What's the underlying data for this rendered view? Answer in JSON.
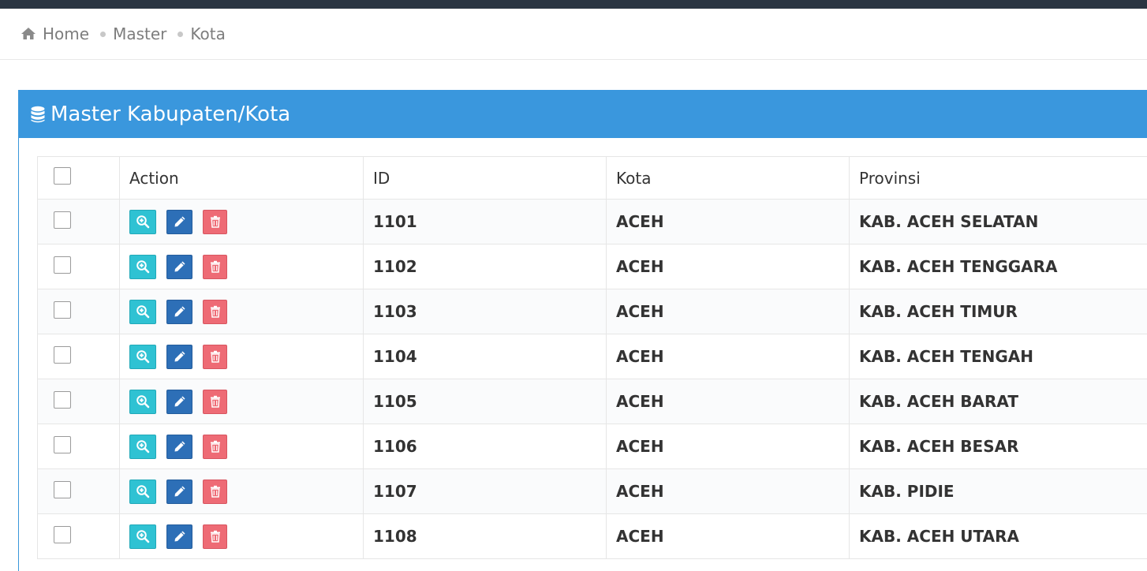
{
  "breadcrumb": {
    "items": [
      "Home",
      "Master",
      "Kota"
    ]
  },
  "panel": {
    "title": "Master Kabupaten/Kota",
    "icon": "database-icon"
  },
  "table": {
    "columns": [
      "Action",
      "ID",
      "Kota",
      "Provinsi"
    ],
    "rows": [
      {
        "id": "1101",
        "kota": "ACEH",
        "provinsi": "KAB. ACEH SELATAN"
      },
      {
        "id": "1102",
        "kota": "ACEH",
        "provinsi": "KAB. ACEH TENGGARA"
      },
      {
        "id": "1103",
        "kota": "ACEH",
        "provinsi": "KAB. ACEH TIMUR"
      },
      {
        "id": "1104",
        "kota": "ACEH",
        "provinsi": "KAB. ACEH TENGAH"
      },
      {
        "id": "1105",
        "kota": "ACEH",
        "provinsi": "KAB. ACEH BARAT"
      },
      {
        "id": "1106",
        "kota": "ACEH",
        "provinsi": "KAB. ACEH BESAR"
      },
      {
        "id": "1107",
        "kota": "ACEH",
        "provinsi": "KAB. PIDIE"
      },
      {
        "id": "1108",
        "kota": "ACEH",
        "provinsi": "KAB. ACEH UTARA"
      }
    ]
  },
  "colors": {
    "topbar": "#2a3542",
    "panel_header": "#3a97dd",
    "view_button": "#2fc2d3",
    "edit_button": "#2d6fb7",
    "delete_button": "#ee6b75"
  },
  "icons": {
    "view": "zoom-in-icon",
    "edit": "pencil-icon",
    "delete": "trash-icon",
    "home": "home-icon"
  }
}
